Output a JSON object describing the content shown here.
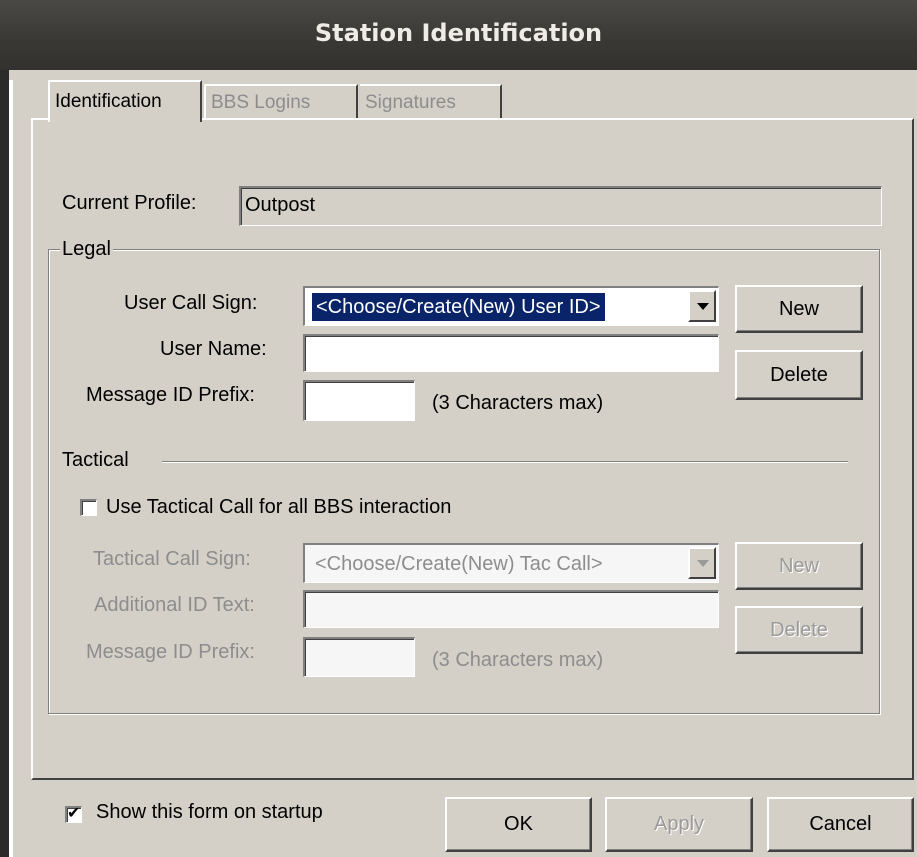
{
  "window": {
    "title": "Station Identification"
  },
  "tabs": [
    {
      "label": "Identification",
      "active": true
    },
    {
      "label": "BBS Logins",
      "enabled": false
    },
    {
      "label": "Signatures",
      "enabled": false
    }
  ],
  "profile": {
    "label": "Current Profile:",
    "value": "Outpost"
  },
  "legal": {
    "group_title": "Legal",
    "call_sign_label": "User Call Sign:",
    "call_sign_value": "<Choose/Create(New) User ID>",
    "user_name_label": "User Name:",
    "user_name_value": "",
    "msg_prefix_label": "Message ID Prefix:",
    "msg_prefix_value": "",
    "msg_prefix_hint": "(3 Characters max)",
    "new_label": "New",
    "delete_label": "Delete"
  },
  "tactical": {
    "section_title": "Tactical",
    "use_tactical_label": "Use Tactical Call for all BBS interaction",
    "use_tactical_checked": false,
    "call_sign_label": "Tactical Call Sign:",
    "call_sign_value": "<Choose/Create(New) Tac Call>",
    "additional_label": "Additional ID Text:",
    "additional_value": "",
    "msg_prefix_label": "Message ID Prefix:",
    "msg_prefix_value": "",
    "msg_prefix_hint": "(3 Characters max)",
    "new_label": "New",
    "delete_label": "Delete"
  },
  "footer": {
    "show_on_startup_label": "Show this form on startup",
    "show_on_startup_checked": true,
    "ok_label": "OK",
    "apply_label": "Apply",
    "cancel_label": "Cancel"
  },
  "colors": {
    "dialog_bg": "#d4d0c8",
    "titlebar_bg": "#3c3b37",
    "selection_bg": "#0a246a",
    "disabled_text": "#8d8d8d"
  }
}
